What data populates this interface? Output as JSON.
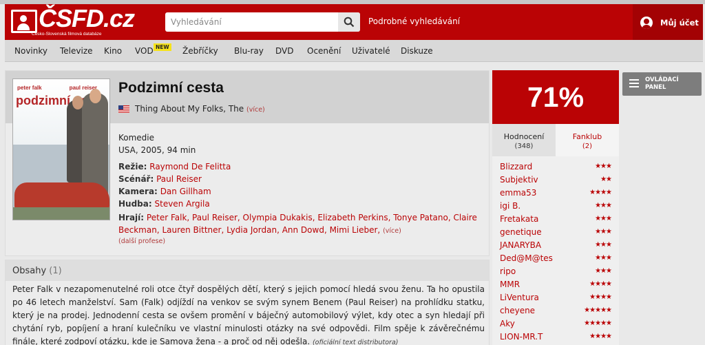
{
  "header": {
    "logo_text": "ČSFD.cz",
    "logo_subtitle": "Česko-Slovenská filmová databáze",
    "search_placeholder": "Vyhledávání",
    "advanced_search": "Podrobné vyhledávání",
    "account": "Můj účet"
  },
  "nav": {
    "items": [
      "Novinky",
      "Televize",
      "Kino",
      "VOD",
      "Žebříčky",
      "Blu-ray",
      "DVD",
      "Ocenění",
      "Uživatelé",
      "Diskuze"
    ],
    "new_badge": "NEW"
  },
  "movie": {
    "title": "Podzimní cesta",
    "original_title": "Thing About My Folks, The",
    "original_title_more": "(více)",
    "genre": "Komedie",
    "origin": "USA, 2005, 94 min",
    "poster": {
      "name1": "peter falk",
      "name2": "paul reiser",
      "title": "podzimní cesta"
    },
    "credits": {
      "director_label": "Režie:",
      "director": "Raymond De Felitta",
      "writer_label": "Scénář:",
      "writer": "Paul Reiser",
      "camera_label": "Kamera:",
      "camera": "Dan Gillham",
      "music_label": "Hudba:",
      "music": "Steven Argila",
      "cast_label": "Hrají:",
      "cast": "Peter Falk, Paul Reiser, Olympia Dukakis, Elizabeth Perkins, Tonye Patano, Claire Beckman, Lauren Bittner, Lydia Jordan, Ann Dowd, Mimi Lieber,",
      "cast_more": "(více)",
      "other_professions": "(další profese)"
    }
  },
  "plot": {
    "heading": "Obsahy",
    "count": "(1)",
    "text": "Peter Falk v nezapomenutelné roli otce čtyř dospělých dětí, který s jejich pomocí hledá svou ženu. Ta ho opustila po 46 letech manželství. Sam (Falk) odjíždí na venkov se svým synem Benem (Paul Reiser) na prohlídku statku, který je na prodej. Jednodenní cesta se ovšem promění v báječný automobilový výlet, kdy otec a syn hledají při chytání ryb, popíjení a hraní kulečníku ve vlastní minulosti otázky na své odpovědi. Film spěje k závěrečnému finále, které zodpoví otázku, kde je Samova žena - a proč od něj odešla.",
    "note": "(oficiální text distributora)"
  },
  "rating": {
    "value": "71%",
    "tabs": [
      {
        "label": "Hodnocení",
        "count": "(348)"
      },
      {
        "label": "Fanklub",
        "count": "(2)"
      }
    ],
    "users": [
      {
        "name": "Blizzard",
        "stars": "★★★"
      },
      {
        "name": "Subjektiv",
        "stars": "★★"
      },
      {
        "name": "emma53",
        "stars": "★★★★"
      },
      {
        "name": "igi B.",
        "stars": "★★★"
      },
      {
        "name": "Fretakata",
        "stars": "★★★"
      },
      {
        "name": "genetique",
        "stars": "★★★"
      },
      {
        "name": "JANARYBA",
        "stars": "★★★"
      },
      {
        "name": "Ded@M@tes",
        "stars": "★★★"
      },
      {
        "name": "ripo",
        "stars": "★★★"
      },
      {
        "name": "MMR",
        "stars": "★★★★"
      },
      {
        "name": "LiVentura",
        "stars": "★★★★"
      },
      {
        "name": "cheyene",
        "stars": "★★★★★"
      },
      {
        "name": "Aky",
        "stars": "★★★★★"
      },
      {
        "name": "LION-MR.T",
        "stars": "★★★★"
      }
    ]
  },
  "control_panel": "OVLÁDACÍ PANEL",
  "colors": {
    "brand_red": "#ba0305",
    "dark_red": "#a30204",
    "badge_yellow": "#f6e31a"
  }
}
